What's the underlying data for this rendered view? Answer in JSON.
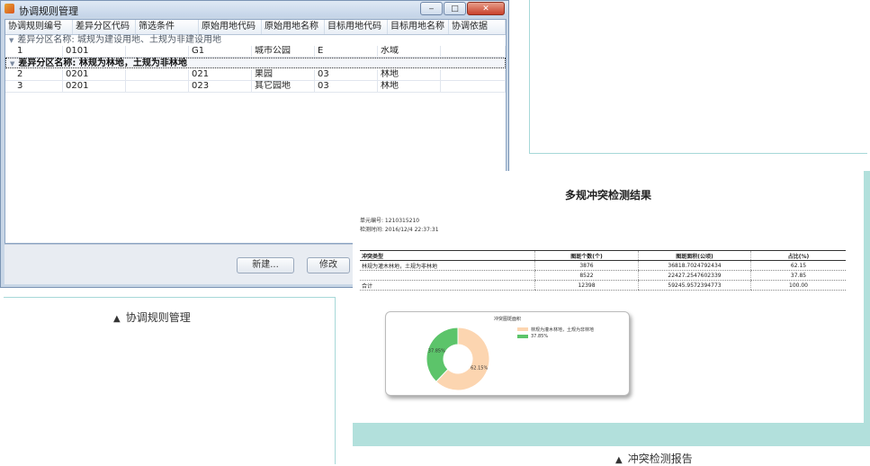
{
  "window": {
    "title": "协调规则管理",
    "buttons": {
      "minimize": "‒",
      "maximize": "□",
      "close": "✕"
    }
  },
  "grid": {
    "columns": [
      "协调规则编号",
      "差异分区代码",
      "筛选条件",
      "原始用地代码",
      "原始用地名称",
      "目标用地代码",
      "目标用地名称",
      "协调依据"
    ],
    "groups": [
      {
        "label": "差异分区名称: 城规为建设用地、土规为非建设用地",
        "rows": [
          [
            "1",
            "0101",
            "",
            "G1",
            "城市公园",
            "E",
            "水域",
            ""
          ]
        ]
      },
      {
        "label": "差异分区名称: 林规为林地，土规为非林地",
        "rows": [
          [
            "2",
            "0201",
            "",
            "021",
            "果园",
            "03",
            "林地",
            ""
          ],
          [
            "3",
            "0201",
            "",
            "023",
            "其它园地",
            "03",
            "林地",
            ""
          ]
        ]
      }
    ]
  },
  "actions": {
    "new_label": "新建...",
    "edit_label": "修改"
  },
  "captions": {
    "rules": "协调规则管理",
    "report": "冲突检测报告",
    "triangle": "▲"
  },
  "report": {
    "title": "多规冲突检测结果",
    "unit_line": "单元编号: 1210315210",
    "time_line": "检测时间: 2016/12/4 22:37:31",
    "table": {
      "headers": [
        "冲突类型",
        "图斑个数(个)",
        "图斑面积(公顷)",
        "占比(%)"
      ],
      "rows": [
        [
          "林规为灌木林地，土规为非林地",
          "3876",
          "36818.7024792434",
          "62.15"
        ],
        [
          "",
          "8522",
          "22427.2547602339",
          "37.85"
        ],
        [
          "合计",
          "12398",
          "59245.9572394773",
          "100.00"
        ]
      ]
    }
  },
  "chart_data": {
    "type": "pie",
    "title": "冲突图斑面积",
    "donut": true,
    "slices": [
      {
        "label": "林规为灌木林地，土规为非林地",
        "value": 62.15,
        "display": "62.15%",
        "color": "#fcd5b0"
      },
      {
        "label": "37.85%",
        "value": 37.85,
        "display": "37.85%",
        "color": "#5cc46a"
      }
    ],
    "legend_position": "right"
  },
  "colors": {
    "accent_teal": "#b2e0dc",
    "window_frame": "#c8d6e6"
  }
}
